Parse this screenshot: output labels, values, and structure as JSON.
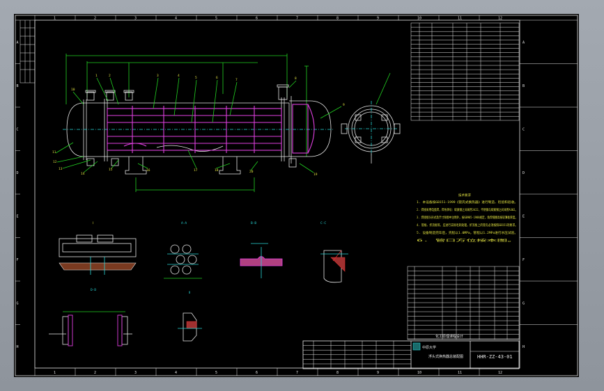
{
  "drawing": {
    "title_line1": "化工原理课程设计",
    "title_line2": "浮头式换热器总装配图",
    "school": "中原大学",
    "drawing_number": "HHR-ZZ-43-01",
    "tech_req_title": "技术要求",
    "tech_requirements": [
      "1. 本设备按GB151-1999《管壳式换热器》进行制造、检验和验收。",
      "2. 焊接采用电弧焊，焊条牌号：碳素钢之间采用J422，不锈钢与碳素钢之间采用A302。",
      "3. 焊接接头形式及尺寸除图中注明外，按GB985-1988规定，角焊缝腰高按较薄板厚度。",
      "4. 管板、折流板等，应进行去除毛刺处理，折流板上的管孔必须按照GB151的要求。",
      "5. 设备制造完毕后，壳程以1.0MPa，管程以1.2MPa进行水压试验。",
      "6. 管口方位按本图。"
    ]
  },
  "border": {
    "col_zones": [
      "1",
      "2",
      "3",
      "4",
      "5",
      "6",
      "7",
      "8",
      "9",
      "10",
      "11",
      "12"
    ],
    "row_zones": [
      "A",
      "B",
      "C",
      "D",
      "E",
      "F",
      "G",
      "H"
    ]
  },
  "views": {
    "detail_1": "Ⅰ",
    "detail_2": "A-A",
    "detail_3": "B-B",
    "detail_4": "C-C",
    "detail_5": "D-D",
    "detail_6": "Ⅱ",
    "detail_7": "E-E"
  },
  "part_numbers": [
    "1",
    "2",
    "3",
    "4",
    "5",
    "6",
    "7",
    "8",
    "9",
    "10",
    "11",
    "12",
    "13",
    "14",
    "15",
    "16",
    "17",
    "18",
    "19",
    "20"
  ],
  "colors": {
    "background": "#000000",
    "outline": "#e8e8e8",
    "dimension": "#22d322",
    "component": "#e040e0",
    "centerline": "#28d7d7",
    "weld": "#e03030",
    "note": "#e0e040"
  }
}
